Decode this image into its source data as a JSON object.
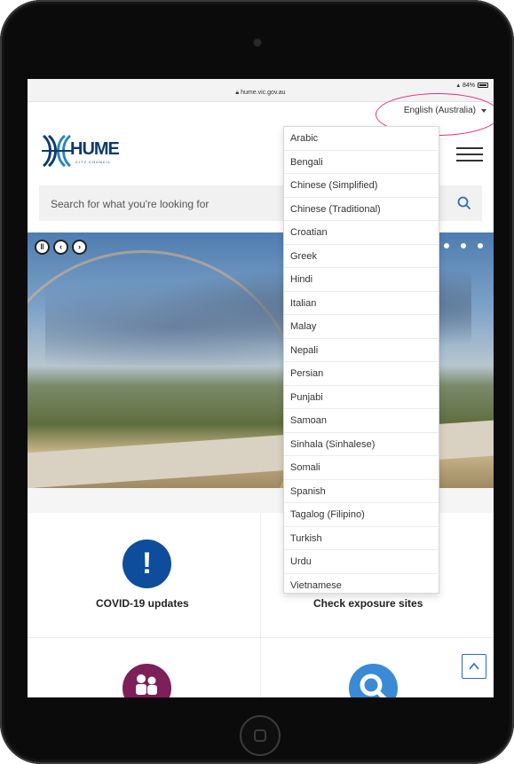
{
  "browser": {
    "url": "hume.vic.gov.au",
    "battery": "84%"
  },
  "language": {
    "selected": "English (Australia)",
    "options": [
      "Arabic",
      "Bengali",
      "Chinese (Simplified)",
      "Chinese (Traditional)",
      "Croatian",
      "Greek",
      "Hindi",
      "Italian",
      "Malay",
      "Nepali",
      "Persian",
      "Punjabi",
      "Samoan",
      "Sinhala (Sinhalese)",
      "Somali",
      "Spanish",
      "Tagalog (Filipino)",
      "Turkish",
      "Urdu",
      "Vietnamese"
    ]
  },
  "header": {
    "logo_text": "HUME",
    "logo_subtext": "CITY COUNCIL"
  },
  "search": {
    "placeholder": "Search for what you're looking for"
  },
  "tiles": [
    {
      "label": "COVID-19 updates",
      "icon": "exclamation-icon"
    },
    {
      "label": "Check exposure sites",
      "icon": "none"
    },
    {
      "icon": "people-icon"
    },
    {
      "icon": "search-icon"
    }
  ],
  "colors": {
    "brand": "#0b3b6e",
    "covid": "#0e4c9c",
    "people": "#7d1f59",
    "search": "#3a8ad6",
    "highlight": "#e2307a"
  }
}
